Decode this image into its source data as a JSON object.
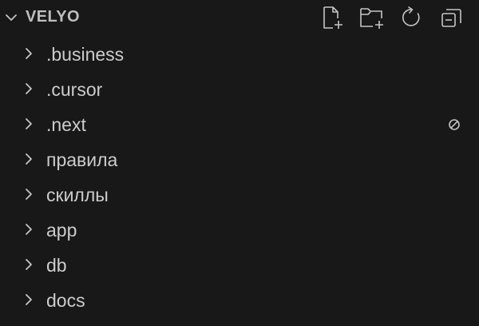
{
  "explorer": {
    "title": "VELYO",
    "toolbar": [
      {
        "name": "new-file-button",
        "icon": "new-file-icon"
      },
      {
        "name": "new-folder-button",
        "icon": "new-folder-icon"
      },
      {
        "name": "refresh-explorer-button",
        "icon": "refresh-icon"
      },
      {
        "name": "collapse-folders-button",
        "icon": "collapse-all-icon"
      }
    ],
    "items": [
      {
        "label": ".business",
        "type": "folder",
        "expanded": false
      },
      {
        "label": ".cursor",
        "type": "folder",
        "expanded": false
      },
      {
        "label": ".next",
        "type": "folder",
        "expanded": false,
        "decoration": "ignored-icon"
      },
      {
        "label": "правила",
        "type": "folder",
        "expanded": false
      },
      {
        "label": "скиллы",
        "type": "folder",
        "expanded": false
      },
      {
        "label": "app",
        "type": "folder",
        "expanded": false
      },
      {
        "label": "db",
        "type": "folder",
        "expanded": false
      },
      {
        "label": "docs",
        "type": "folder",
        "expanded": false
      }
    ]
  },
  "colors": {
    "background": "#181818",
    "text": "#cccccc",
    "icon": "#c5c5c5"
  }
}
